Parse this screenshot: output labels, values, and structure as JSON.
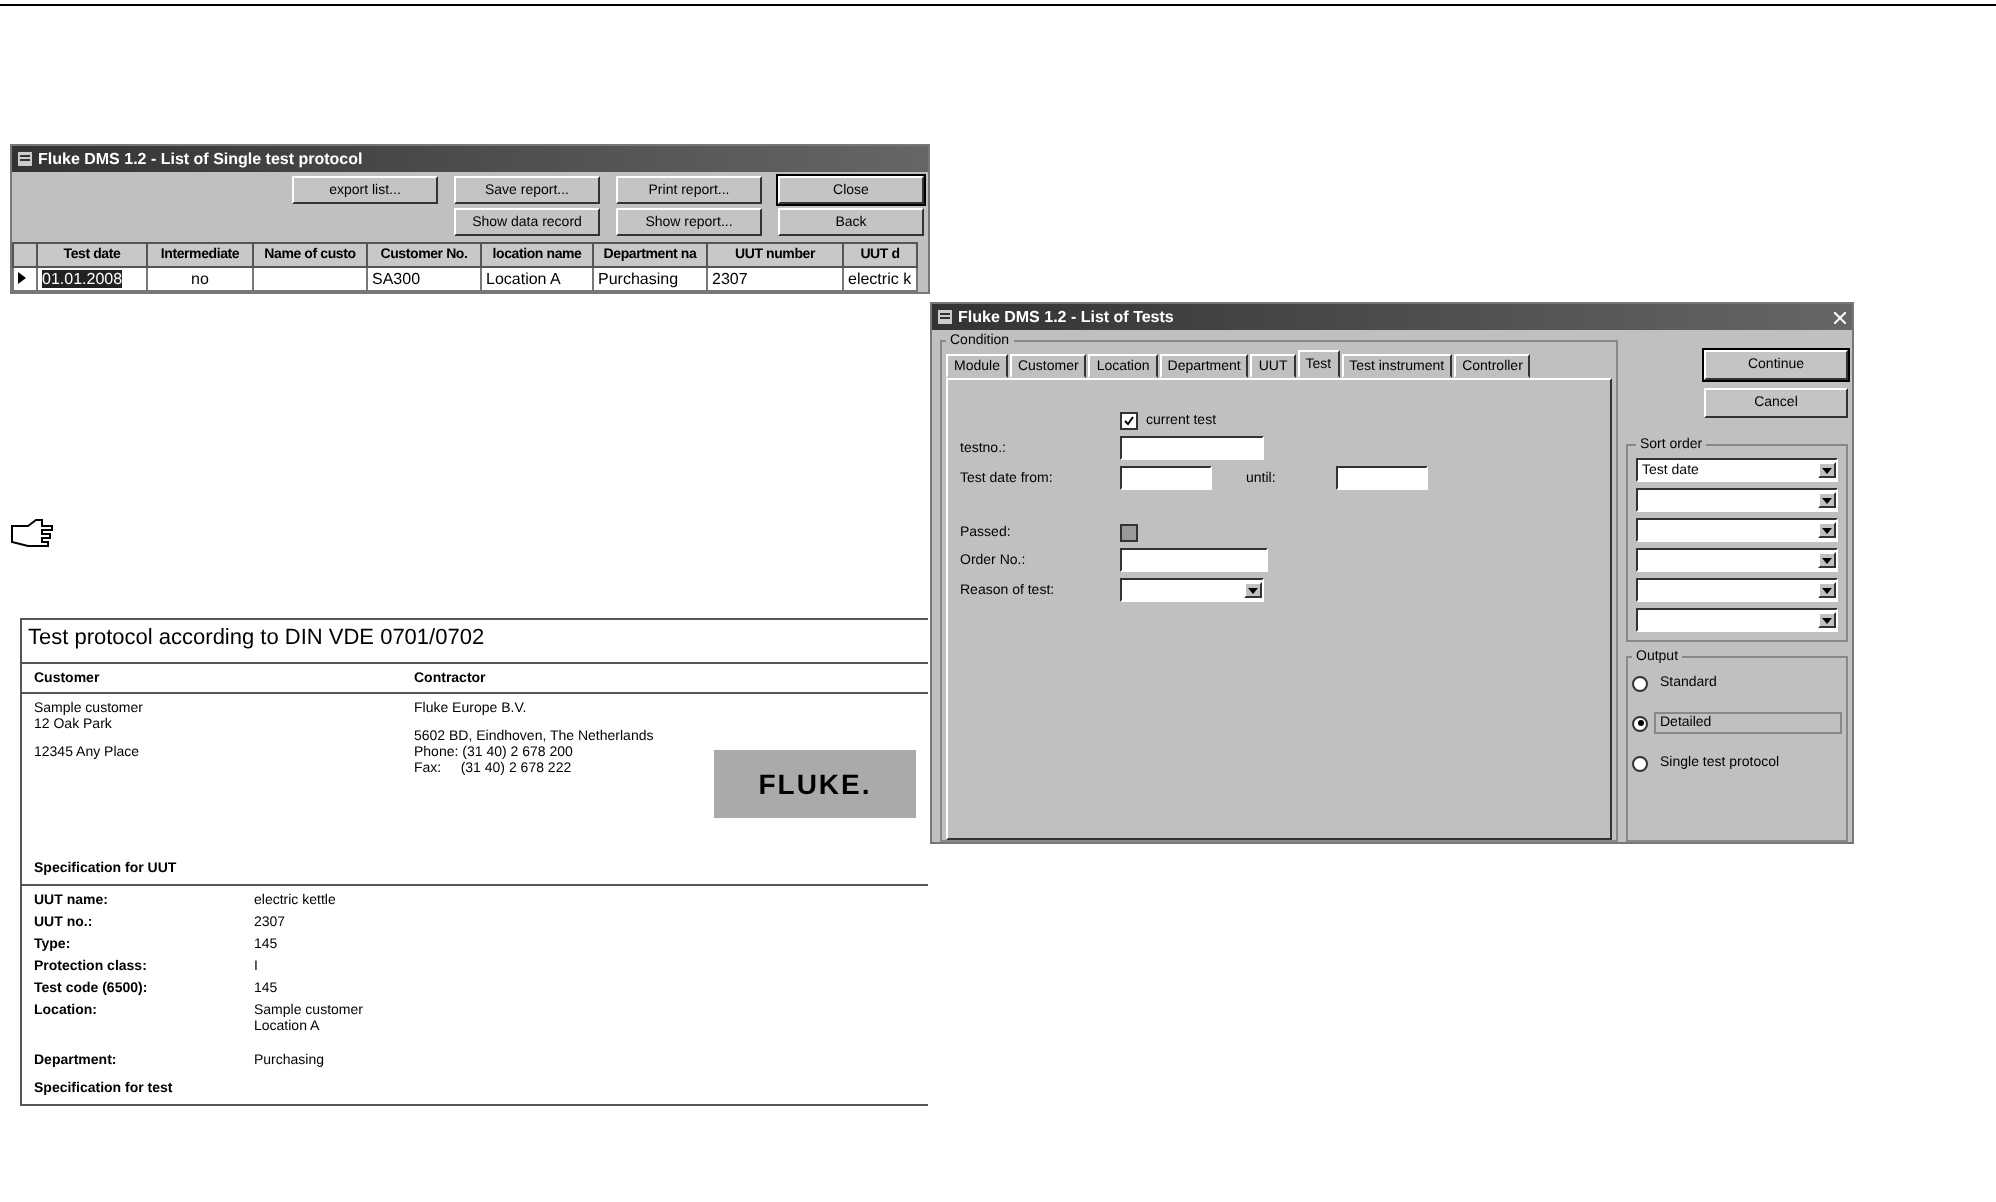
{
  "list_window": {
    "title": "Fluke DMS 1.2 - List of Single test protocol",
    "button_rows": [
      [
        {
          "label": "export list...",
          "default": false
        },
        {
          "label": "Save report...",
          "default": false
        },
        {
          "label": "Print report...",
          "default": false
        },
        {
          "label": "Close",
          "default": true
        }
      ],
      [
        {
          "label": "Show data record",
          "default": false
        },
        {
          "label": "Show report...",
          "default": false
        },
        {
          "label": "Back",
          "default": false
        }
      ]
    ],
    "columns": [
      "Test date",
      "Intermediate",
      "Name of custo",
      "Customer No.",
      "location name",
      "Department na",
      "UUT number",
      "UUT d"
    ],
    "rows": [
      {
        "selected": true,
        "cells": [
          "01.01.2008",
          "no",
          null,
          "SA300",
          "Location A",
          "Purchasing",
          "2307",
          "electric k"
        ]
      }
    ]
  },
  "protocol_document": {
    "title": "Test protocol according to DIN VDE 0701/0702",
    "customer_heading": "Customer",
    "contractor_heading": "Contractor",
    "customer_lines": [
      [
        "Sample customer",
        "12 Oak Park"
      ],
      [
        "12345 Any Place"
      ]
    ],
    "contractor_lines": [
      [
        "Fluke Europe B.V."
      ],
      [
        "5602 BD, Eindhoven, The Netherlands",
        "Phone: (31 40) 2 678 200",
        "Fax:     (31 40) 2 678 222"
      ]
    ],
    "logo": "FLUKE.",
    "uut_heading": "Specification for UUT",
    "uut_fields": [
      {
        "label": "UUT name:",
        "value": [
          "electric kettle"
        ]
      },
      {
        "label": "UUT no.:",
        "value": [
          "2307"
        ]
      },
      {
        "label": "Type:",
        "value": [
          "145"
        ]
      },
      {
        "label": "Protection class:",
        "value": [
          "I"
        ]
      },
      {
        "label": "Test code (6500):",
        "value": [
          "145"
        ]
      },
      {
        "label": "Location:",
        "value": [
          "Sample customer",
          "Location A"
        ]
      },
      {
        "label": "Department:",
        "value": [
          "Purchasing"
        ]
      }
    ],
    "test_heading": "Specification for test"
  },
  "tests_window": {
    "title": "Fluke DMS 1.2 - List of Tests",
    "condition_label": "Condition",
    "tabs": [
      {
        "label": "Module",
        "selected": false
      },
      {
        "label": "Customer",
        "selected": false
      },
      {
        "label": "Location",
        "selected": false
      },
      {
        "label": "Department",
        "selected": false
      },
      {
        "label": "UUT",
        "selected": false
      },
      {
        "label": "Test",
        "selected": true
      },
      {
        "label": "Test instrument",
        "selected": false
      },
      {
        "label": "Controller",
        "selected": false
      }
    ],
    "current_test": {
      "label": "current test",
      "checked": true
    },
    "testno_label": "testno.:",
    "date_from_label": "Test date from:",
    "until_label": "until:",
    "passed": {
      "label": "Passed:",
      "checked": false,
      "disabled": true
    },
    "order_label": "Order No.:",
    "reason_label": "Reason of test:",
    "buttons": [
      "Continue",
      "Cancel"
    ],
    "sort_label": "Sort order",
    "sort_fields": [
      {
        "kind": "dropdown",
        "value": "Test date"
      },
      {
        "kind": "dropdown"
      },
      {
        "kind": "dropdown"
      },
      {
        "kind": "dropdown"
      },
      {
        "kind": "dropdown"
      },
      {
        "kind": "dropdown"
      }
    ],
    "output_label": "Output",
    "output_options": [
      {
        "label": "Standard",
        "selected": false
      },
      {
        "label": "Detailed",
        "selected": true
      },
      {
        "label": "Single test protocol",
        "selected": false
      }
    ]
  }
}
